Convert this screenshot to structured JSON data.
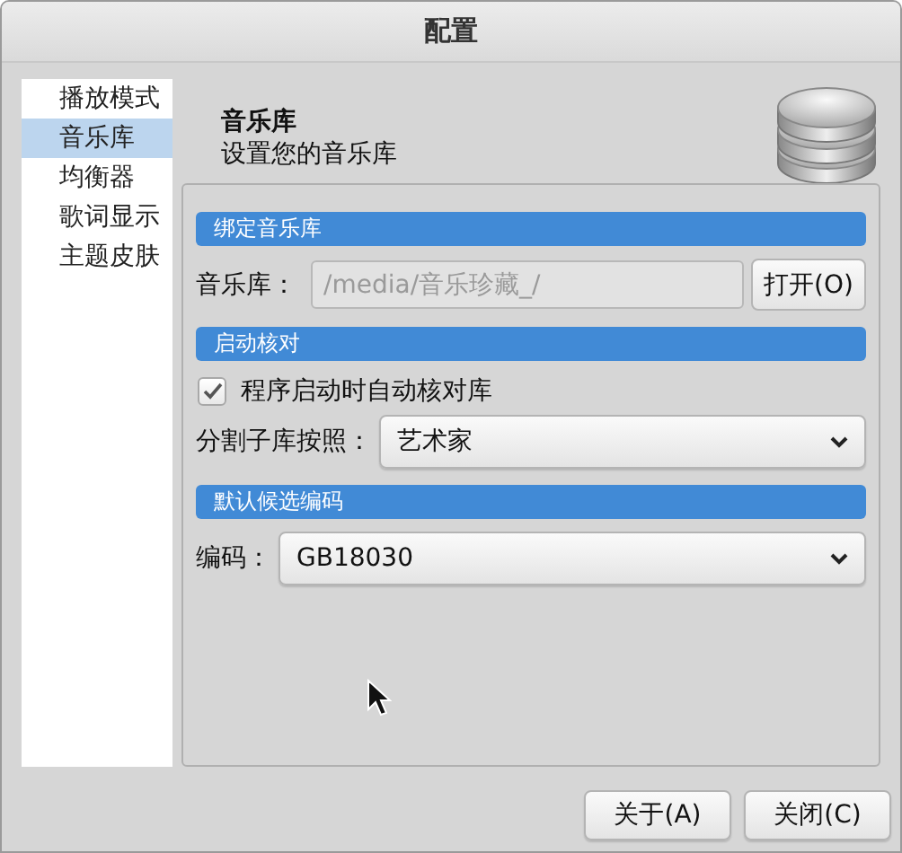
{
  "window": {
    "title": "配置"
  },
  "sidebar": {
    "items": [
      {
        "label": "播放模式",
        "selected": false
      },
      {
        "label": "音乐库",
        "selected": true
      },
      {
        "label": "均衡器",
        "selected": false
      },
      {
        "label": "歌词显示",
        "selected": false
      },
      {
        "label": "主题皮肤",
        "selected": false
      }
    ]
  },
  "header": {
    "title": "音乐库",
    "subtitle": "设置您的音乐库"
  },
  "sections": [
    {
      "title": "绑定音乐库",
      "rows": [
        {
          "kind": "path",
          "label": "音乐库：",
          "value": "/media/音乐珍藏_/",
          "disabled": true,
          "button": "打开(O)"
        }
      ]
    },
    {
      "title": "启动核对",
      "rows": [
        {
          "kind": "checkbox",
          "label": "程序启动时自动核对库",
          "checked": true
        },
        {
          "kind": "combo",
          "label": "分割子库按照：",
          "value": "艺术家"
        }
      ]
    },
    {
      "title": "默认候选编码",
      "rows": [
        {
          "kind": "combo",
          "label": "编码：",
          "value": "GB18030"
        }
      ]
    }
  ],
  "buttons": [
    "关于(A)",
    "关闭(C)"
  ]
}
